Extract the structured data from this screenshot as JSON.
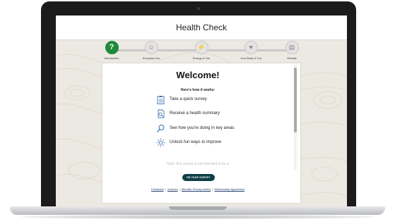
{
  "app": {
    "title": "Health Check"
  },
  "progress": {
    "steps": [
      {
        "label": "Introduction",
        "active": true,
        "symbol": "?"
      },
      {
        "label": "Everyday You",
        "active": false,
        "symbol": "☺"
      },
      {
        "label": "Energy & You",
        "active": false,
        "symbol": "⚡"
      },
      {
        "label": "Your Body & You",
        "active": false,
        "symbol": "♥"
      },
      {
        "label": "Results",
        "active": false,
        "symbol": "▤"
      }
    ]
  },
  "welcome": {
    "title": "Welcome!",
    "subtitle": "Here's how it works:",
    "items": [
      {
        "text": "Take a quick survey",
        "icon": "clipboard-icon"
      },
      {
        "text": "Receive a health summary",
        "icon": "summary-icon"
      },
      {
        "text": "See how you're doing in key areas",
        "icon": "magnifier-icon"
      },
      {
        "text": "Unlock fun ways to improve",
        "icon": "sun-icon"
      }
    ],
    "note": "Note: this survey is not intended to be a",
    "cta": "RE-TAKE SURVEY"
  },
  "footer": {
    "links": [
      "Feedback",
      "Sources",
      "Member Privacy Notice",
      "Membership Agreement"
    ],
    "separator": "|"
  },
  "colors": {
    "accent": "#1e8a3c",
    "cta": "#0f3f46",
    "link": "#1f3a6f"
  }
}
